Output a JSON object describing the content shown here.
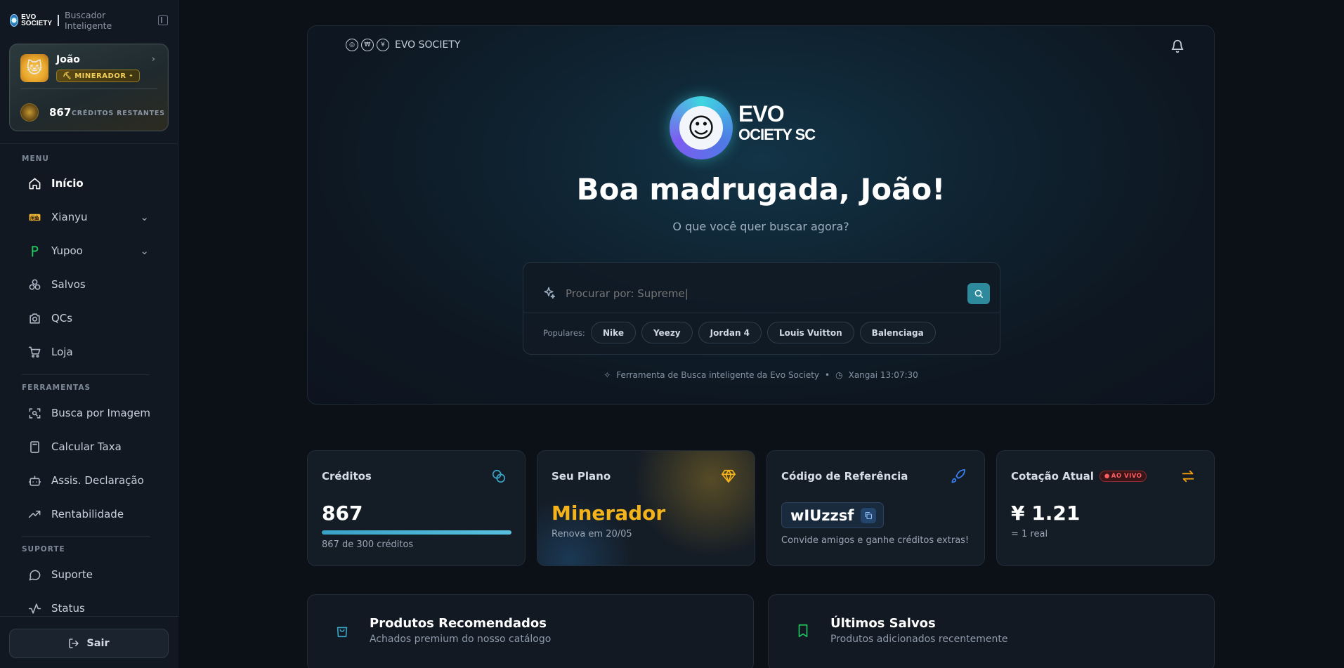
{
  "sidebar": {
    "brand_sub": "Buscador Inteligente",
    "logo_text": "EVO SOCIETY",
    "user": {
      "name": "João",
      "badge": "MINERADOR",
      "credits": "867",
      "credits_label": "CRÉDITOS RESTANTES"
    },
    "sections": {
      "menu": "MENU",
      "tools": "FERRAMENTAS",
      "support": "SUPORTE"
    },
    "menu_items": [
      {
        "label": "Início",
        "icon": "home-icon"
      },
      {
        "label": "Xianyu",
        "icon": "xianyu-icon"
      },
      {
        "label": "Yupoo",
        "icon": "yupoo-icon"
      },
      {
        "label": "Salvos",
        "icon": "saved-icon"
      },
      {
        "label": "QCs",
        "icon": "camera-icon"
      },
      {
        "label": "Loja",
        "icon": "cart-icon"
      }
    ],
    "tool_items": [
      {
        "label": "Busca por Imagem",
        "icon": "image-search-icon"
      },
      {
        "label": "Calcular Taxa",
        "icon": "calculator-icon"
      },
      {
        "label": "Assis. Declaração",
        "icon": "bot-icon"
      },
      {
        "label": "Rentabilidade",
        "icon": "trending-icon"
      }
    ],
    "support_items": [
      {
        "label": "Suporte",
        "icon": "chat-icon"
      },
      {
        "label": "Status",
        "icon": "pulse-icon"
      }
    ],
    "logout": "Sair"
  },
  "hero": {
    "topbar_brand": "EVO SOCIETY",
    "wordmark_line1": "EVO",
    "wordmark_line2": "OCIETY SC",
    "title": "Boa madrugada, João!",
    "subtitle": "O que você quer buscar agora?",
    "search": {
      "placeholder": "Procurar por: Supreme|",
      "popular_label": "Populares:",
      "chips": [
        "Nike",
        "Yeezy",
        "Jordan 4",
        "Louis Vuitton",
        "Balenciaga"
      ]
    },
    "footer_tool": "Ferramenta de Busca inteligente da Evo Society",
    "footer_time": "Xangai 13:07:30"
  },
  "stats": {
    "credits": {
      "title": "Créditos",
      "value": "867",
      "sub": "867 de 300 créditos",
      "progress": 1.0
    },
    "plan": {
      "title": "Seu Plano",
      "value": "Minerador",
      "sub": "Renova em 20/05"
    },
    "referral": {
      "title": "Código de Referência",
      "code": "wIUzzsf",
      "sub": "Convide amigos e ganhe créditos extras!"
    },
    "rate": {
      "title": "Cotação Atual",
      "live": "AO VIVO",
      "value": "¥ 1.21",
      "sub": "= 1 real"
    }
  },
  "sections": {
    "recommended": {
      "title": "Produtos Recomendados",
      "sub": "Achados premium do nosso catálogo"
    },
    "saved": {
      "title": "Últimos Salvos",
      "sub": "Produtos adicionados recentemente"
    }
  },
  "colors": {
    "accent": "#2c8a9c",
    "plan_gold": "#f5b31b",
    "referral_blue": "#3b82f6",
    "rate_orange": "#f59e0b"
  }
}
